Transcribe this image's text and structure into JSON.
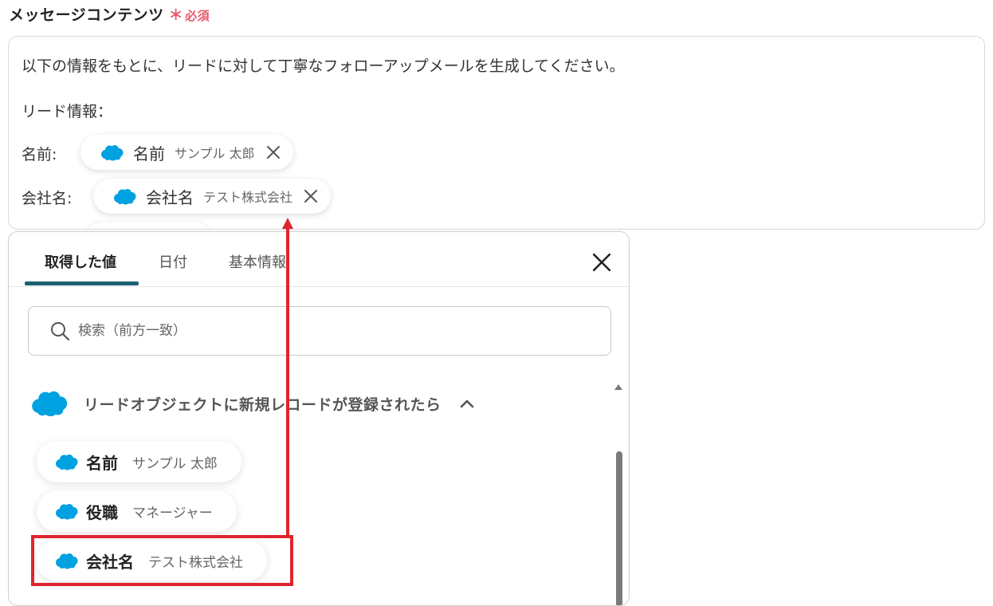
{
  "field": {
    "label": "メッセージコンテンツ",
    "required_mark": "＊",
    "required_text": "必須"
  },
  "editor": {
    "line1": "以下の情報をもとに、リードに対して丁寧なフォローアップメールを生成してください。",
    "line2": "リード情報：",
    "rows": [
      {
        "prefix": "名前:",
        "chip_label": "名前",
        "chip_value": "サンプル 太郎"
      },
      {
        "prefix": "会社名:",
        "chip_label": "会社名",
        "chip_value": "テスト株式会社"
      }
    ]
  },
  "panel": {
    "tabs": [
      {
        "label": "取得した値",
        "active": true
      },
      {
        "label": "日付",
        "active": false
      },
      {
        "label": "基本情報",
        "active": false
      }
    ],
    "search_placeholder": "検索（前方一致）",
    "section_title": "リードオブジェクトに新規レコードが登録されたら",
    "items": [
      {
        "label": "名前",
        "value": "サンプル 太郎"
      },
      {
        "label": "役職",
        "value": "マネージャー"
      },
      {
        "label": "会社名",
        "value": "テスト株式会社"
      }
    ]
  },
  "icons": {
    "salesforce": "salesforce-cloud-icon",
    "close": "close-icon",
    "search": "search-icon",
    "chevron": "chevron-up-icon"
  },
  "colors": {
    "salesforce_blue": "#00A1E0",
    "required_red": "#E8586A",
    "active_tab_underline": "#1D6173",
    "highlight_red": "#E0242F"
  }
}
